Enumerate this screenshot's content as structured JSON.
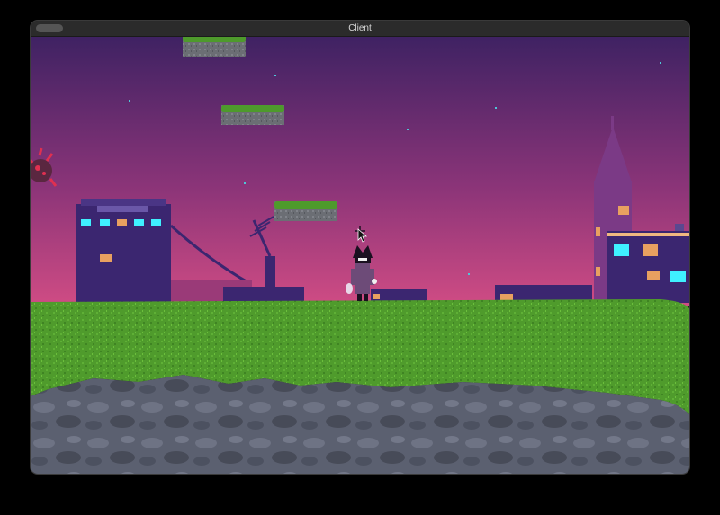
{
  "window": {
    "title": "Client"
  },
  "scene": {
    "sky_top_color": "#3f2263",
    "sky_bottom_color": "#d04c84",
    "grass_color": "#4f9b2c",
    "rock_color": "#5b6070",
    "building_color": "#3b2670",
    "window_cyan": "#3ff0ff",
    "window_orange": "#e8a060",
    "floating_platforms": 3,
    "icons": {
      "player": "hooded-character-icon",
      "enemy": "spiky-red-creature-icon",
      "cursor": "arrow-cursor-icon"
    }
  }
}
